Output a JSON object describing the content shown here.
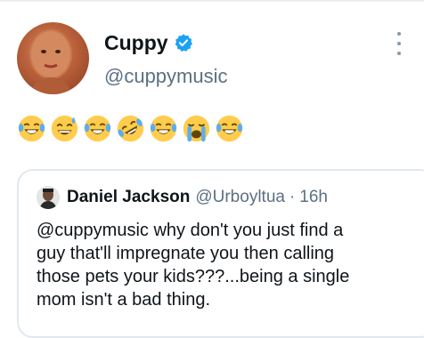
{
  "tweet": {
    "author_name": "Cuppy",
    "author_handle": "@cuppymusic",
    "emojis": [
      "joy-emoji",
      "sweat-smile-emoji",
      "joy-emoji",
      "rofl-emoji",
      "joy-emoji",
      "loudly-crying-emoji",
      "joy-emoji"
    ]
  },
  "quoted_tweet": {
    "author_name": "Daniel Jackson",
    "author_handle": "@Urboyltua",
    "separator": "·",
    "time": "16h",
    "text": "@cuppymusic  why don't you just find a\nguy that'll impregnate you then calling\nthose pets your kids???...being a single\nmom isn't a bad thing."
  },
  "colors": {
    "verified_blue": "#1da1f2",
    "secondary_text": "#5b7083",
    "emoji_yellow": "#ffcc4d",
    "tear_blue": "#5dadec"
  }
}
